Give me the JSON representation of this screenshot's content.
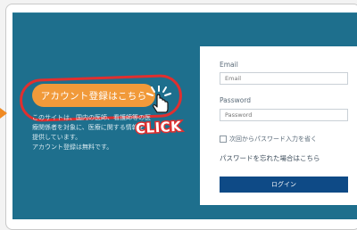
{
  "register": {
    "button_label": "アカウント登録はこちら",
    "description_lines": [
      "このサイトは、国内の医師、看護師等の医",
      "療関係者を対象に、医療に関する情報を",
      "提供しています。",
      "アカウント登録は無料です。"
    ],
    "callout": "CLICK"
  },
  "login": {
    "email_label": "Email",
    "email_placeholder": "Email",
    "password_label": "Password",
    "password_placeholder": "Password",
    "remember_label": "次回からパスワード入力を省く",
    "forgot_link": "パスワードを忘れた場合はこちら",
    "login_button": "ログイン"
  },
  "colors": {
    "panel": "#1e6f8d",
    "register_button": "#f19a3a",
    "highlight": "#e02f2f",
    "login_button": "#0e4a86"
  },
  "icons": {
    "cursor": "hand-pointer-icon",
    "click_burst": "click-burst-icon",
    "side_marker": "arrow-right-icon"
  }
}
